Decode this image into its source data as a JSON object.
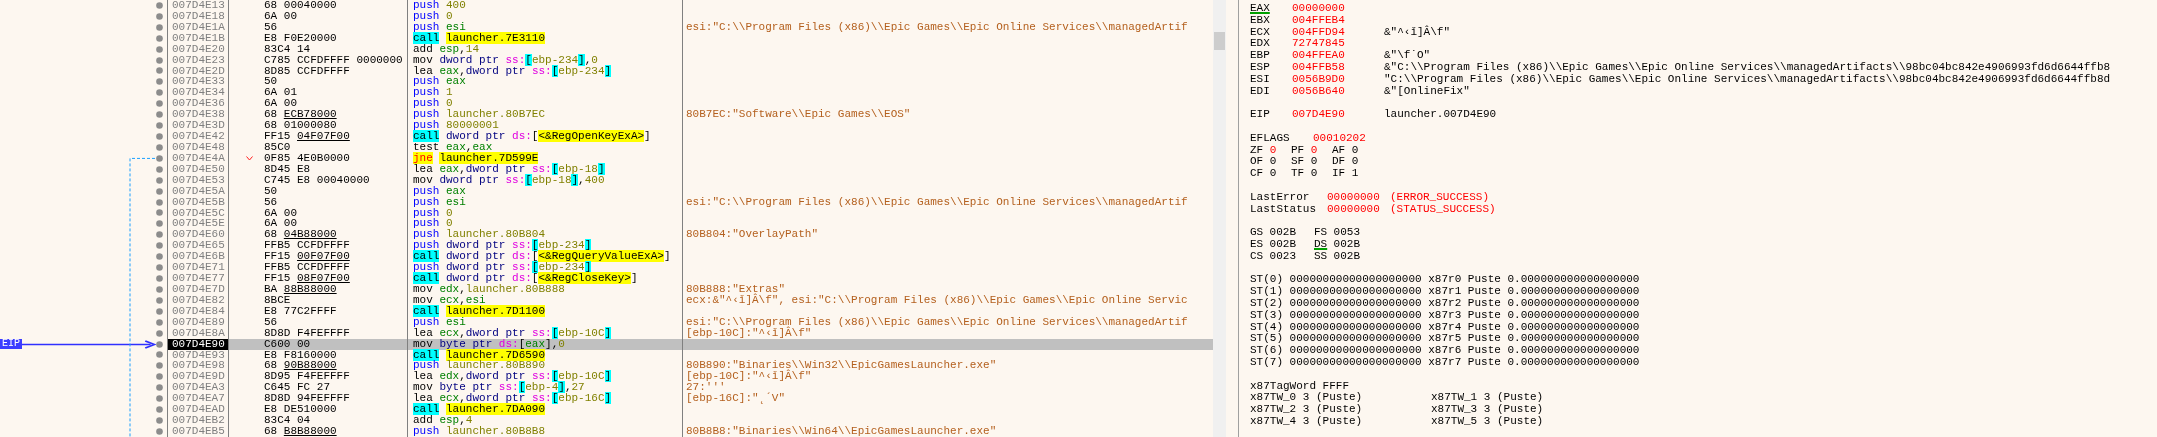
{
  "disassembly": {
    "eip_label": "EIP",
    "rows": [
      {
        "address": "007D4E13",
        "opcode": "68",
        "operand_bytes": "00040000",
        "underlined": false,
        "mnemonic": "push",
        "kind": "push",
        "ops": [
          {
            "kind": "num",
            "text": "400"
          }
        ],
        "selected": false,
        "jump": false
      },
      {
        "address": "007D4E18",
        "opcode": "6A",
        "operand_bytes": "00",
        "underlined": false,
        "mnemonic": "push",
        "kind": "push",
        "ops": [
          {
            "kind": "num",
            "text": "0"
          }
        ],
        "selected": false,
        "jump": false
      },
      {
        "address": "007D4E1A",
        "opcode": "56",
        "mnemonic": "push",
        "kind": "push",
        "ops": [
          {
            "kind": "reg",
            "text": "esi"
          }
        ],
        "comment": "esi:\"C:\\\\Program Files (x86)\\\\Epic Games\\\\Epic Online Services\\\\managedArtif",
        "selected": false,
        "jump": false
      },
      {
        "address": "007D4E1B",
        "opcode": "E8",
        "operand_bytes": "F0E20000",
        "underlined": false,
        "mnemonic": "call",
        "kind": "call",
        "ops": [
          {
            "kind": "target",
            "text": "launcher.7E3110"
          }
        ],
        "selected": false,
        "jump": false
      },
      {
        "address": "007D4E20",
        "opcode": "83C4",
        "operand_bytes": "14",
        "underlined": false,
        "mnemonic": "add",
        "kind": "plain",
        "ops": [
          {
            "kind": "reg",
            "text": "esp"
          },
          {
            "kind": "punct",
            "text": ","
          },
          {
            "kind": "num",
            "text": "14"
          }
        ],
        "selected": false,
        "jump": false
      },
      {
        "address": "007D4E23",
        "opcode": "C785",
        "operand_bytes": "CCFDFFFF 0000000",
        "underlined": false,
        "mnemonic": "mov",
        "kind": "plain",
        "ops": [
          {
            "kind": "size",
            "text": "dword ptr"
          },
          {
            "kind": "seg",
            "text": "ss:"
          },
          {
            "kind": "lb",
            "text": "["
          },
          {
            "kind": "mem",
            "text": "ebp-234"
          },
          {
            "kind": "rb",
            "text": "]"
          },
          {
            "kind": "punct",
            "text": ","
          },
          {
            "kind": "num",
            "text": "0"
          }
        ],
        "selected": false,
        "jump": false
      },
      {
        "address": "007D4E2D",
        "opcode": "8D85",
        "operand_bytes": "CCFDFFFF",
        "underlined": false,
        "mnemonic": "lea",
        "kind": "plain",
        "ops": [
          {
            "kind": "reg",
            "text": "eax"
          },
          {
            "kind": "punct",
            "text": ","
          },
          {
            "kind": "size",
            "text": "dword ptr"
          },
          {
            "kind": "seg",
            "text": "ss:"
          },
          {
            "kind": "lb",
            "text": "["
          },
          {
            "kind": "mem",
            "text": "ebp-234"
          },
          {
            "kind": "rb",
            "text": "]"
          }
        ],
        "selected": false,
        "jump": false
      },
      {
        "address": "007D4E33",
        "opcode": "50",
        "mnemonic": "push",
        "kind": "push",
        "ops": [
          {
            "kind": "reg",
            "text": "eax"
          }
        ],
        "selected": false,
        "jump": false
      },
      {
        "address": "007D4E34",
        "opcode": "6A",
        "operand_bytes": "01",
        "underlined": false,
        "mnemonic": "push",
        "kind": "push",
        "ops": [
          {
            "kind": "num",
            "text": "1"
          }
        ],
        "selected": false,
        "jump": false
      },
      {
        "address": "007D4E36",
        "opcode": "6A",
        "operand_bytes": "00",
        "underlined": false,
        "mnemonic": "push",
        "kind": "push",
        "ops": [
          {
            "kind": "num",
            "text": "0"
          }
        ],
        "selected": false,
        "jump": false
      },
      {
        "address": "007D4E38",
        "opcode": "68",
        "operand_bytes": "ECB78000",
        "underlined": true,
        "mnemonic": "push",
        "kind": "push",
        "ops": [
          {
            "kind": "sym",
            "text": "launcher.80B7EC"
          }
        ],
        "comment": "80B7EC:\"Software\\\\Epic Games\\\\EOS\"",
        "selected": false,
        "jump": false
      },
      {
        "address": "007D4E3D",
        "opcode": "68",
        "operand_bytes": "01000080",
        "underlined": false,
        "mnemonic": "push",
        "kind": "push",
        "ops": [
          {
            "kind": "num",
            "text": "80000001"
          }
        ],
        "selected": false,
        "jump": false
      },
      {
        "address": "007D4E42",
        "opcode": "FF15",
        "operand_bytes": "04F07F00",
        "underlined": true,
        "mnemonic": "call",
        "kind": "call",
        "ops": [
          {
            "kind": "size",
            "text": "dword ptr"
          },
          {
            "kind": "seg",
            "text": "ds:"
          },
          {
            "kind": "punct",
            "text": "["
          },
          {
            "kind": "api",
            "text": "<&RegOpenKeyExA>"
          },
          {
            "kind": "punct",
            "text": "]"
          }
        ],
        "selected": false,
        "jump": false
      },
      {
        "address": "007D4E48",
        "opcode": "85C0",
        "mnemonic": "test",
        "kind": "plain",
        "ops": [
          {
            "kind": "reg",
            "text": "eax"
          },
          {
            "kind": "punct",
            "text": ","
          },
          {
            "kind": "reg",
            "text": "eax"
          }
        ],
        "selected": false,
        "jump": false
      },
      {
        "address": "007D4E4A",
        "opcode": "0F85",
        "operand_bytes": "4E0B0000",
        "underlined": false,
        "mnemonic": "jne",
        "kind": "jump",
        "ops": [
          {
            "kind": "target",
            "text": "launcher.7D599E"
          }
        ],
        "selected": false,
        "jump": true
      },
      {
        "address": "007D4E50",
        "opcode": "8D45",
        "operand_bytes": "E8",
        "underlined": false,
        "mnemonic": "lea",
        "kind": "plain",
        "ops": [
          {
            "kind": "reg",
            "text": "eax"
          },
          {
            "kind": "punct",
            "text": ","
          },
          {
            "kind": "size",
            "text": "dword ptr"
          },
          {
            "kind": "seg",
            "text": "ss:"
          },
          {
            "kind": "lb",
            "text": "["
          },
          {
            "kind": "mem",
            "text": "ebp-18"
          },
          {
            "kind": "rb",
            "text": "]"
          }
        ],
        "selected": false,
        "jump": false
      },
      {
        "address": "007D4E53",
        "opcode": "C745",
        "operand_bytes": "E8 00040000",
        "underlined": false,
        "mnemonic": "mov",
        "kind": "plain",
        "ops": [
          {
            "kind": "size",
            "text": "dword ptr"
          },
          {
            "kind": "seg",
            "text": "ss:"
          },
          {
            "kind": "lb",
            "text": "["
          },
          {
            "kind": "mem",
            "text": "ebp-18"
          },
          {
            "kind": "rb",
            "text": "]"
          },
          {
            "kind": "punct",
            "text": ","
          },
          {
            "kind": "num",
            "text": "400"
          }
        ],
        "selected": false,
        "jump": false
      },
      {
        "address": "007D4E5A",
        "opcode": "50",
        "mnemonic": "push",
        "kind": "push",
        "ops": [
          {
            "kind": "reg",
            "text": "eax"
          }
        ],
        "selected": false,
        "jump": false
      },
      {
        "address": "007D4E5B",
        "opcode": "56",
        "mnemonic": "push",
        "kind": "push",
        "ops": [
          {
            "kind": "reg",
            "text": "esi"
          }
        ],
        "comment": "esi:\"C:\\\\Program Files (x86)\\\\Epic Games\\\\Epic Online Services\\\\managedArtif",
        "selected": false,
        "jump": false
      },
      {
        "address": "007D4E5C",
        "opcode": "6A",
        "operand_bytes": "00",
        "underlined": false,
        "mnemonic": "push",
        "kind": "push",
        "ops": [
          {
            "kind": "num",
            "text": "0"
          }
        ],
        "selected": false,
        "jump": false
      },
      {
        "address": "007D4E5E",
        "opcode": "6A",
        "operand_bytes": "00",
        "underlined": false,
        "mnemonic": "push",
        "kind": "push",
        "ops": [
          {
            "kind": "num",
            "text": "0"
          }
        ],
        "selected": false,
        "jump": false
      },
      {
        "address": "007D4E60",
        "opcode": "68",
        "operand_bytes": "04B88000",
        "underlined": true,
        "mnemonic": "push",
        "kind": "push",
        "ops": [
          {
            "kind": "sym",
            "text": "launcher.80B804"
          }
        ],
        "comment": "80B804:\"OverlayPath\"",
        "selected": false,
        "jump": false
      },
      {
        "address": "007D4E65",
        "opcode": "FFB5",
        "operand_bytes": "CCFDFFFF",
        "underlined": false,
        "mnemonic": "push",
        "kind": "push",
        "ops": [
          {
            "kind": "size",
            "text": "dword ptr"
          },
          {
            "kind": "seg",
            "text": "ss:"
          },
          {
            "kind": "lb",
            "text": "["
          },
          {
            "kind": "mem",
            "text": "ebp-234"
          },
          {
            "kind": "rb",
            "text": "]"
          }
        ],
        "selected": false,
        "jump": false
      },
      {
        "address": "007D4E6B",
        "opcode": "FF15",
        "operand_bytes": "00F07F00",
        "underlined": true,
        "mnemonic": "call",
        "kind": "call",
        "ops": [
          {
            "kind": "size",
            "text": "dword ptr"
          },
          {
            "kind": "seg",
            "text": "ds:"
          },
          {
            "kind": "punct",
            "text": "["
          },
          {
            "kind": "api",
            "text": "<&RegQueryValueExA>"
          },
          {
            "kind": "punct",
            "text": "]"
          }
        ],
        "selected": false,
        "jump": false
      },
      {
        "address": "007D4E71",
        "opcode": "FFB5",
        "operand_bytes": "CCFDFFFF",
        "underlined": false,
        "mnemonic": "push",
        "kind": "push",
        "ops": [
          {
            "kind": "size",
            "text": "dword ptr"
          },
          {
            "kind": "seg",
            "text": "ss:"
          },
          {
            "kind": "lb",
            "text": "["
          },
          {
            "kind": "mem",
            "text": "ebp-234"
          },
          {
            "kind": "rb",
            "text": "]"
          }
        ],
        "selected": false,
        "jump": false
      },
      {
        "address": "007D4E77",
        "opcode": "FF15",
        "operand_bytes": "08F07F00",
        "underlined": true,
        "mnemonic": "call",
        "kind": "call",
        "ops": [
          {
            "kind": "size",
            "text": "dword ptr"
          },
          {
            "kind": "seg",
            "text": "ds:"
          },
          {
            "kind": "punct",
            "text": "["
          },
          {
            "kind": "api",
            "text": "<&RegCloseKey>"
          },
          {
            "kind": "punct",
            "text": "]"
          }
        ],
        "selected": false,
        "jump": false
      },
      {
        "address": "007D4E7D",
        "opcode": "BA",
        "operand_bytes": "88B88000",
        "underlined": true,
        "mnemonic": "mov",
        "kind": "plain",
        "ops": [
          {
            "kind": "reg",
            "text": "edx"
          },
          {
            "kind": "punct",
            "text": ","
          },
          {
            "kind": "sym",
            "text": "launcher.80B888"
          }
        ],
        "comment": "80B888:\"Extras\"",
        "selected": false,
        "jump": false
      },
      {
        "address": "007D4E82",
        "opcode": "8BCE",
        "mnemonic": "mov",
        "kind": "plain",
        "ops": [
          {
            "kind": "reg",
            "text": "ecx"
          },
          {
            "kind": "punct",
            "text": ","
          },
          {
            "kind": "reg",
            "text": "esi"
          }
        ],
        "comment": "ecx:&\"^‹ǐ]Â\\f\", esi:\"C:\\\\Program Files (x86)\\\\Epic Games\\\\Epic Online Servic",
        "selected": false,
        "jump": false
      },
      {
        "address": "007D4E84",
        "opcode": "E8",
        "operand_bytes": "77C2FFFF",
        "underlined": false,
        "mnemonic": "call",
        "kind": "call",
        "ops": [
          {
            "kind": "target",
            "text": "launcher.7D1100"
          }
        ],
        "selected": false,
        "jump": false
      },
      {
        "address": "007D4E89",
        "opcode": "56",
        "mnemonic": "push",
        "kind": "push",
        "ops": [
          {
            "kind": "reg",
            "text": "esi"
          }
        ],
        "comment": "esi:\"C:\\\\Program Files (x86)\\\\Epic Games\\\\Epic Online Services\\\\managedArtif",
        "selected": false,
        "jump": false
      },
      {
        "address": "007D4E8A",
        "opcode": "8D8D",
        "operand_bytes": "F4FEFFFF",
        "underlined": false,
        "mnemonic": "lea",
        "kind": "plain",
        "ops": [
          {
            "kind": "reg",
            "text": "ecx"
          },
          {
            "kind": "punct",
            "text": ","
          },
          {
            "kind": "size",
            "text": "dword ptr"
          },
          {
            "kind": "seg",
            "text": "ss:"
          },
          {
            "kind": "lb",
            "text": "["
          },
          {
            "kind": "mem",
            "text": "ebp-10C"
          },
          {
            "kind": "rb",
            "text": "]"
          }
        ],
        "comment": "[ebp-10C]:\"^‹ǐ]Â\\f\"",
        "selected": false,
        "jump": false
      },
      {
        "address": "007D4E90",
        "opcode": "C600",
        "operand_bytes": "00",
        "underlined": false,
        "mnemonic": "mov",
        "kind": "plain",
        "ops": [
          {
            "kind": "size",
            "text": "byte ptr"
          },
          {
            "kind": "seg",
            "text": "ds:"
          },
          {
            "kind": "punct",
            "text": "["
          },
          {
            "kind": "reg",
            "text": "eax"
          },
          {
            "kind": "punct",
            "text": "]"
          },
          {
            "kind": "punct",
            "text": ","
          },
          {
            "kind": "num",
            "text": "0"
          }
        ],
        "selected": true,
        "jump": false
      },
      {
        "address": "007D4E93",
        "opcode": "E8",
        "operand_bytes": "F8160000",
        "underlined": false,
        "mnemonic": "call",
        "kind": "call",
        "ops": [
          {
            "kind": "target",
            "text": "launcher.7D6590"
          }
        ],
        "selected": false,
        "jump": false
      },
      {
        "address": "007D4E98",
        "opcode": "68",
        "operand_bytes": "90B88000",
        "underlined": true,
        "mnemonic": "push",
        "kind": "push",
        "ops": [
          {
            "kind": "sym",
            "text": "launcher.80B890"
          }
        ],
        "comment": "80B890:\"Binaries\\\\Win32\\\\EpicGamesLauncher.exe\"",
        "selected": false,
        "jump": false
      },
      {
        "address": "007D4E9D",
        "opcode": "8D95",
        "operand_bytes": "F4FEFFFF",
        "underlined": false,
        "mnemonic": "lea",
        "kind": "plain",
        "ops": [
          {
            "kind": "reg",
            "text": "edx"
          },
          {
            "kind": "punct",
            "text": ","
          },
          {
            "kind": "size",
            "text": "dword ptr"
          },
          {
            "kind": "seg",
            "text": "ss:"
          },
          {
            "kind": "lb",
            "text": "["
          },
          {
            "kind": "mem",
            "text": "ebp-10C"
          },
          {
            "kind": "rb",
            "text": "]"
          }
        ],
        "comment": "[ebp-10C]:\"^‹ǐ]Â\\f\"",
        "selected": false,
        "jump": false
      },
      {
        "address": "007D4EA3",
        "opcode": "C645",
        "operand_bytes": "FC 27",
        "underlined": false,
        "mnemonic": "mov",
        "kind": "plain",
        "ops": [
          {
            "kind": "size",
            "text": "byte ptr"
          },
          {
            "kind": "seg",
            "text": "ss:"
          },
          {
            "kind": "lb",
            "text": "["
          },
          {
            "kind": "mem",
            "text": "ebp-4"
          },
          {
            "kind": "rb",
            "text": "]"
          },
          {
            "kind": "punct",
            "text": ","
          },
          {
            "kind": "num",
            "text": "27"
          }
        ],
        "comment": "27:'''",
        "selected": false,
        "jump": false
      },
      {
        "address": "007D4EA7",
        "opcode": "8D8D",
        "operand_bytes": "94FEFFFF",
        "underlined": false,
        "mnemonic": "lea",
        "kind": "plain",
        "ops": [
          {
            "kind": "reg",
            "text": "ecx"
          },
          {
            "kind": "punct",
            "text": ","
          },
          {
            "kind": "size",
            "text": "dword ptr"
          },
          {
            "kind": "seg",
            "text": "ss:"
          },
          {
            "kind": "lb",
            "text": "["
          },
          {
            "kind": "mem",
            "text": "ebp-16C"
          },
          {
            "kind": "rb",
            "text": "]"
          }
        ],
        "comment": "[ebp-16C]:\"˛´V\"",
        "selected": false,
        "jump": false
      },
      {
        "address": "007D4EAD",
        "opcode": "E8",
        "operand_bytes": "DE510000",
        "underlined": false,
        "mnemonic": "call",
        "kind": "call",
        "ops": [
          {
            "kind": "target",
            "text": "launcher.7DA090"
          }
        ],
        "selected": false,
        "jump": false
      },
      {
        "address": "007D4EB2",
        "opcode": "83C4",
        "operand_bytes": "04",
        "underlined": false,
        "mnemonic": "add",
        "kind": "plain",
        "ops": [
          {
            "kind": "reg",
            "text": "esp"
          },
          {
            "kind": "punct",
            "text": ","
          },
          {
            "kind": "num",
            "text": "4"
          }
        ],
        "selected": false,
        "jump": false
      },
      {
        "address": "007D4EB5",
        "opcode": "68",
        "operand_bytes": "B8B88000",
        "underlined": true,
        "mnemonic": "push",
        "kind": "push",
        "ops": [
          {
            "kind": "sym",
            "text": "launcher.80B8B8"
          }
        ],
        "comment": "80B8B8:\"Binaries\\\\Win64\\\\EpicGamesLauncher.exe\"",
        "selected": false,
        "jump": false
      }
    ]
  },
  "registers": {
    "general": [
      {
        "name": "EAX",
        "value": "00000000",
        "changed": true,
        "underlined": true
      },
      {
        "name": "EBX",
        "value": "004FFEB4",
        "changed": true,
        "underlined": false
      },
      {
        "name": "ECX",
        "value": "004FFD94",
        "changed": true,
        "underlined": false,
        "comment": "&\"^‹ǐ]Â\\f\""
      },
      {
        "name": "EDX",
        "value": "72747845",
        "changed": true,
        "underlined": false
      },
      {
        "name": "EBP",
        "value": "004FFEA0",
        "changed": true,
        "underlined": false,
        "comment": "&\"\\f˙O\""
      },
      {
        "name": "ESP",
        "value": "004FFB58",
        "changed": true,
        "underlined": false,
        "comment": "&\"C:\\\\Program Files (x86)\\\\Epic Games\\\\Epic Online Services\\\\managedArtifacts\\\\98bc04bc842e4906993fd6d6644ffb8"
      },
      {
        "name": "ESI",
        "value": "0056B9D0",
        "changed": true,
        "underlined": false,
        "comment": "\"C:\\\\Program Files (x86)\\\\Epic Games\\\\Epic Online Services\\\\managedArtifacts\\\\98bc04bc842e4906993fd6d6644ffb8d"
      },
      {
        "name": "EDI",
        "value": "0056B640",
        "changed": true,
        "underlined": false,
        "comment": "&\"[OnlineFix\""
      }
    ],
    "eip": {
      "name": "EIP",
      "value": "007D4E90",
      "changed": true,
      "comment": "launcher.007D4E90"
    },
    "eflags": {
      "name": "EFLAGS",
      "value": "00010202",
      "changed": true
    },
    "flags": [
      [
        {
          "name": "ZF",
          "value": "0",
          "changed": true
        },
        {
          "name": "PF",
          "value": "0",
          "changed": true
        },
        {
          "name": "AF",
          "value": "0",
          "changed": false
        }
      ],
      [
        {
          "name": "OF",
          "value": "0",
          "changed": false
        },
        {
          "name": "SF",
          "value": "0",
          "changed": false
        },
        {
          "name": "DF",
          "value": "0",
          "changed": false
        }
      ],
      [
        {
          "name": "CF",
          "value": "0",
          "changed": false
        },
        {
          "name": "TF",
          "value": "0",
          "changed": false
        },
        {
          "name": "IF",
          "value": "1",
          "changed": false
        }
      ]
    ],
    "last": [
      {
        "name": "LastError",
        "value": "00000000",
        "description": "(ERROR_SUCCESS)",
        "changed": true
      },
      {
        "name": "LastStatus",
        "value": "00000000",
        "description": "(STATUS_SUCCESS)",
        "changed": true
      }
    ],
    "segments": [
      [
        {
          "name": "GS",
          "value": "002B",
          "underlined": false
        },
        {
          "name": "FS",
          "value": "0053",
          "underlined": false
        }
      ],
      [
        {
          "name": "ES",
          "value": "002B",
          "underlined": false
        },
        {
          "name": "DS",
          "value": "002B",
          "underlined": true
        }
      ],
      [
        {
          "name": "CS",
          "value": "0023",
          "underlined": false
        },
        {
          "name": "SS",
          "value": "002B",
          "underlined": false
        }
      ]
    ],
    "fpu": [
      "ST(0) 00000000000000000000 x87r0 Puste 0.000000000000000000",
      "ST(1) 00000000000000000000 x87r1 Puste 0.000000000000000000",
      "ST(2) 00000000000000000000 x87r2 Puste 0.000000000000000000",
      "ST(3) 00000000000000000000 x87r3 Puste 0.000000000000000000",
      "ST(4) 00000000000000000000 x87r4 Puste 0.000000000000000000",
      "ST(5) 00000000000000000000 x87r5 Puste 0.000000000000000000",
      "ST(6) 00000000000000000000 x87r6 Puste 0.000000000000000000",
      "ST(7) 00000000000000000000 x87r7 Puste 0.000000000000000000"
    ],
    "tag_word": "x87TagWord FFFF",
    "tag_words": [
      [
        "x87TW_0 3 (Puste)",
        "x87TW_1 3 (Puste)"
      ],
      [
        "x87TW_2 3 (Puste)",
        "x87TW_3 3 (Puste)"
      ],
      [
        "x87TW_4 3 (Puste)",
        "x87TW_5 3 (Puste)"
      ]
    ]
  }
}
